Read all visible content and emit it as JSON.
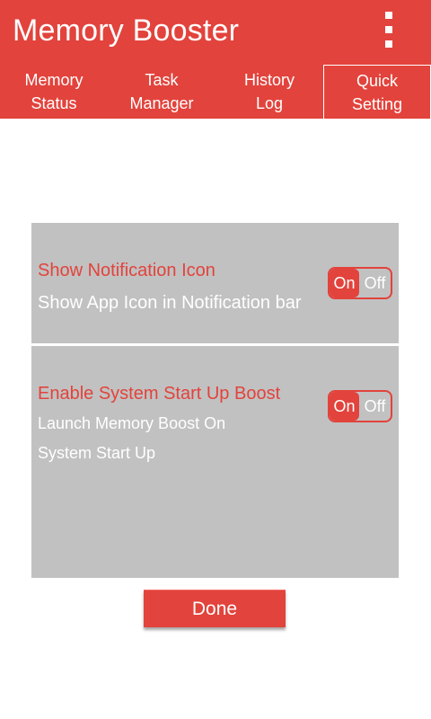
{
  "app": {
    "title": "Memory Booster",
    "accent_color": "#e2433c",
    "overflow_icon": "more-vertical-icon"
  },
  "tabs": [
    {
      "label": "Memory\nStatus",
      "active": false
    },
    {
      "label": "Task\nManager",
      "active": false
    },
    {
      "label": "History\nLog",
      "active": false
    },
    {
      "label": "Quick\nSetting",
      "active": true
    }
  ],
  "settings": [
    {
      "title": "Show Notification Icon",
      "description": "Show App Icon in Notification bar",
      "toggle": {
        "on_label": "On",
        "off_label": "Off",
        "state": "on"
      }
    },
    {
      "title": "Enable System Start Up Boost",
      "description": "Launch Memory Boost On\nSystem Start Up",
      "toggle": {
        "on_label": "On",
        "off_label": "Off",
        "state": "on"
      }
    }
  ],
  "done_label": "Done"
}
